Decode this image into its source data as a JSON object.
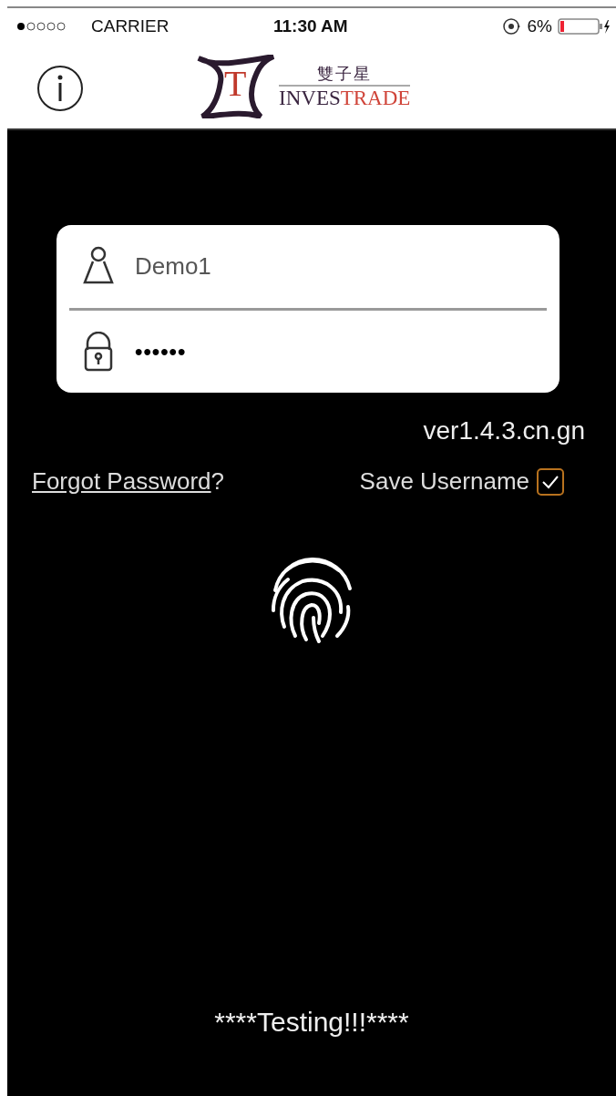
{
  "status_bar": {
    "carrier": "CARRIER",
    "time": "11:30 AM",
    "battery": "6%"
  },
  "header": {
    "logo_mark_letter": "T",
    "logo_chinese": "雙子星",
    "logo_word_dark": "INVES",
    "logo_word_red": "TRADE"
  },
  "login": {
    "username": {
      "value": "Demo1"
    },
    "password": {
      "value": "••••••"
    }
  },
  "version": "ver1.4.3.cn.gn",
  "forgot_password": {
    "link": "Forgot Password",
    "suffix": "?"
  },
  "save_username": {
    "label": "Save Username",
    "checked": true
  },
  "footer": "****Testing!!!****"
}
